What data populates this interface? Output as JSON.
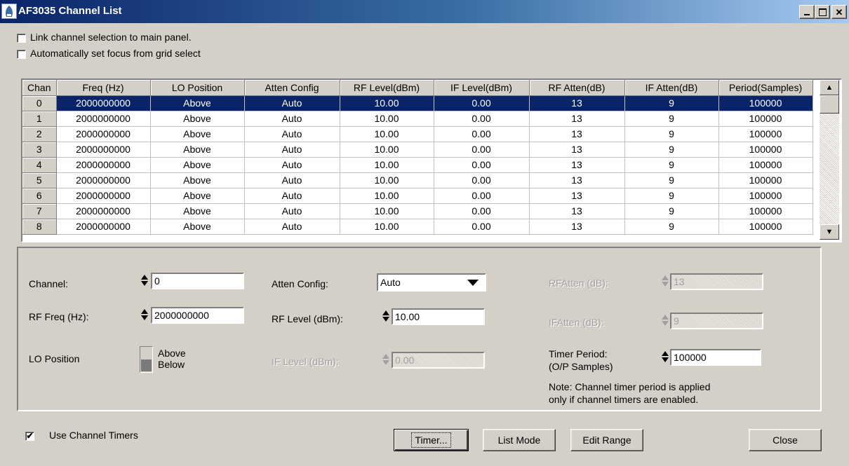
{
  "window": {
    "title": "AF3035 Channel List",
    "minimize_icon": "minimize-icon",
    "maximize_icon": "maximize-icon",
    "close_icon": "close-icon"
  },
  "options": {
    "link_selection_label": "Link channel selection to main panel.",
    "link_selection_checked": false,
    "auto_focus_label": "Automatically set focus from grid select",
    "auto_focus_checked": false
  },
  "grid": {
    "columns": [
      "Chan",
      "Freq (Hz)",
      "LO Position",
      "Atten Config",
      "RF Level(dBm)",
      "IF Level(dBm)",
      "RF Atten(dB)",
      "IF Atten(dB)",
      "Period(Samples)"
    ],
    "selected_row": 0,
    "rows": [
      [
        "0",
        "2000000000",
        "Above",
        "Auto",
        "10.00",
        "0.00",
        "13",
        "9",
        "100000"
      ],
      [
        "1",
        "2000000000",
        "Above",
        "Auto",
        "10.00",
        "0.00",
        "13",
        "9",
        "100000"
      ],
      [
        "2",
        "2000000000",
        "Above",
        "Auto",
        "10.00",
        "0.00",
        "13",
        "9",
        "100000"
      ],
      [
        "3",
        "2000000000",
        "Above",
        "Auto",
        "10.00",
        "0.00",
        "13",
        "9",
        "100000"
      ],
      [
        "4",
        "2000000000",
        "Above",
        "Auto",
        "10.00",
        "0.00",
        "13",
        "9",
        "100000"
      ],
      [
        "5",
        "2000000000",
        "Above",
        "Auto",
        "10.00",
        "0.00",
        "13",
        "9",
        "100000"
      ],
      [
        "6",
        "2000000000",
        "Above",
        "Auto",
        "10.00",
        "0.00",
        "13",
        "9",
        "100000"
      ],
      [
        "7",
        "2000000000",
        "Above",
        "Auto",
        "10.00",
        "0.00",
        "13",
        "9",
        "100000"
      ],
      [
        "8",
        "2000000000",
        "Above",
        "Auto",
        "10.00",
        "0.00",
        "13",
        "9",
        "100000"
      ]
    ]
  },
  "panel": {
    "channel_label": "Channel:",
    "channel_value": "0",
    "rf_freq_label": "RF Freq (Hz):",
    "rf_freq_value": "2000000000",
    "lo_position_label": "LO Position",
    "lo_above": "Above",
    "lo_below": "Below",
    "atten_config_label": "Atten Config:",
    "atten_config_value": "Auto",
    "rf_level_label": "RF Level (dBm):",
    "rf_level_value": "10.00",
    "if_level_label": "IF Level (dBm):",
    "if_level_value": "0.00",
    "rf_atten_label": "RFAtten (dB):",
    "rf_atten_value": "13",
    "if_atten_label": "IFAtten (dB):",
    "if_atten_value": "9",
    "timer_period_label_1": "Timer Period:",
    "timer_period_label_2": "(O/P Samples)",
    "timer_period_value": "100000",
    "note_line_1": "Note: Channel timer period is applied",
    "note_line_2": "only if channel timers are enabled."
  },
  "footer": {
    "use_timers_label": "Use Channel Timers",
    "use_timers_checked": true,
    "timer_button": "Timer...",
    "list_mode_button": "List Mode",
    "edit_range_button": "Edit Range",
    "close_button": "Close"
  }
}
